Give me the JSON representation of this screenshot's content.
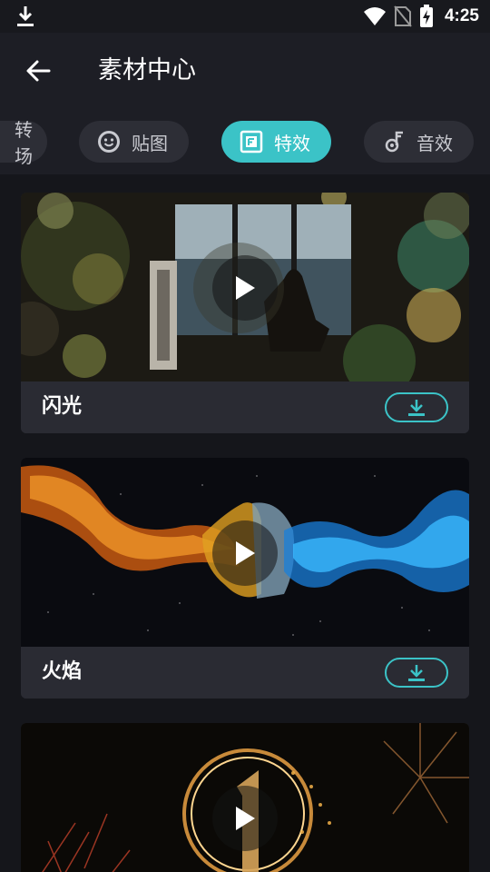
{
  "status_bar": {
    "time": "4:25"
  },
  "header": {
    "title": "素材中心"
  },
  "tabs": [
    {
      "label": "转场",
      "icon": "transition-icon",
      "active": false
    },
    {
      "label": "贴图",
      "icon": "sticker-face-icon",
      "active": false
    },
    {
      "label": "特效",
      "icon": "effect-frame-icon",
      "active": true
    },
    {
      "label": "音效",
      "icon": "music-note-icon",
      "active": false
    }
  ],
  "cards": [
    {
      "title": "闪光",
      "theme": "bokeh-window"
    },
    {
      "title": "火焰",
      "theme": "fire-ice-smoke"
    },
    {
      "title": "",
      "theme": "fireworks-countdown"
    }
  ],
  "colors": {
    "accent": "#3bc3c7",
    "background": "#1d1e25",
    "card": "#2a2b33"
  }
}
